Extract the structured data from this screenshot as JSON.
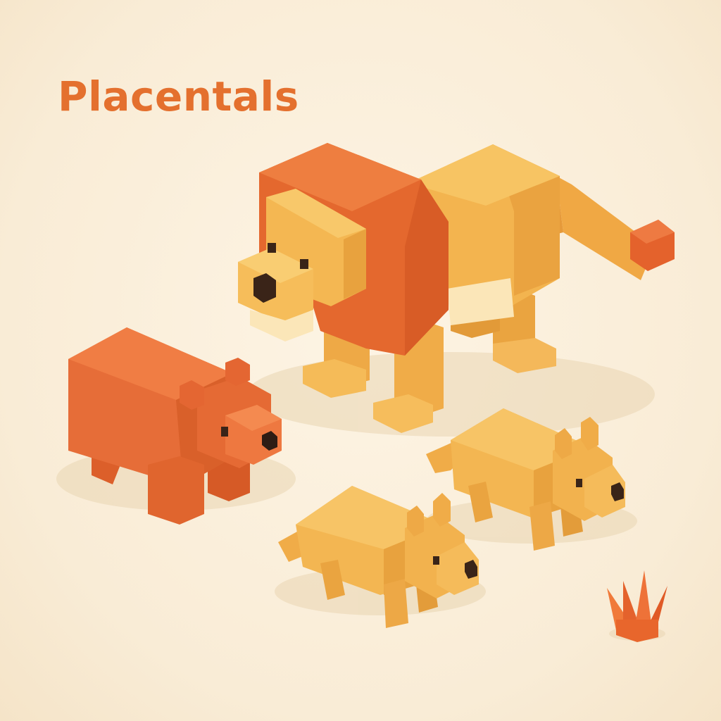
{
  "title": "Placentals",
  "palette": {
    "background": "#fbf0dc",
    "title": "#e4702e",
    "mane": "#e06c34",
    "lion_body": "#f2b24e",
    "bear": "#e56b36",
    "cub": "#f3b652",
    "cream": "#fbe6b8",
    "grass": "#e8662c"
  },
  "figures": [
    "lion",
    "bear",
    "cub",
    "cub",
    "grass"
  ]
}
